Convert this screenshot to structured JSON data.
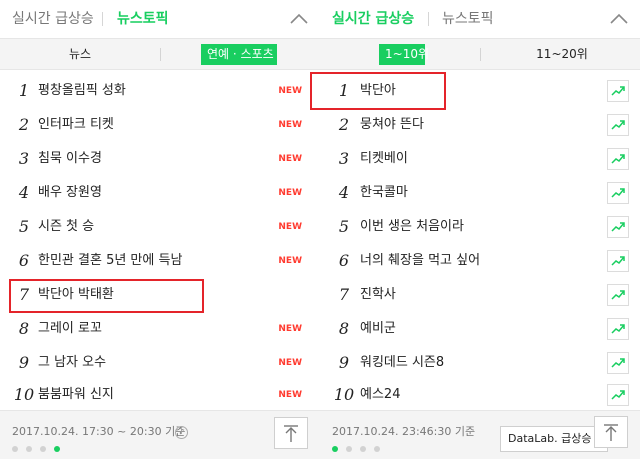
{
  "colors": {
    "accent": "#19ce60",
    "new": "#ff3b30",
    "highlight": "#e4242a"
  },
  "left": {
    "header": {
      "tab1": "실시간 급상승",
      "tab2": "뉴스토픽",
      "active": "tab2"
    },
    "subtabs": {
      "tab1": "뉴스",
      "tab2": "연예 · 스포츠",
      "active": "tab2"
    },
    "items": [
      {
        "rank": "1",
        "keyword": "평창올림픽 성화",
        "badge": "NEW"
      },
      {
        "rank": "2",
        "keyword": "인터파크 티켓",
        "badge": "NEW"
      },
      {
        "rank": "3",
        "keyword": "침묵 이수경",
        "badge": "NEW"
      },
      {
        "rank": "4",
        "keyword": "배우 장원영",
        "badge": "NEW"
      },
      {
        "rank": "5",
        "keyword": "시즌 첫 승",
        "badge": "NEW"
      },
      {
        "rank": "6",
        "keyword": "한민관 결혼 5년 만에 득남",
        "badge": "NEW"
      },
      {
        "rank": "7",
        "keyword": "박단아 박태환",
        "badge": ""
      },
      {
        "rank": "8",
        "keyword": "그레이 로꼬",
        "badge": "NEW"
      },
      {
        "rank": "9",
        "keyword": "그 남자 오수",
        "badge": "NEW"
      },
      {
        "rank": "10",
        "keyword": "붐붐파워 신지",
        "badge": "NEW"
      }
    ],
    "footer": {
      "date": "2017.10.24. 17:30 ~ 20:30 기준",
      "info": "i"
    }
  },
  "right": {
    "header": {
      "tab1": "실시간 급상승",
      "tab2": "뉴스토픽",
      "active": "tab1"
    },
    "subtabs": {
      "tab1": "1~10위",
      "tab2": "11~20위",
      "active": "tab1"
    },
    "items": [
      {
        "rank": "1",
        "keyword": "박단아"
      },
      {
        "rank": "2",
        "keyword": "뭉쳐야 뜬다"
      },
      {
        "rank": "3",
        "keyword": "티켓베이"
      },
      {
        "rank": "4",
        "keyword": "한국콜마"
      },
      {
        "rank": "5",
        "keyword": "이번 생은 처음이라"
      },
      {
        "rank": "6",
        "keyword": "너의 췌장을 먹고 싶어"
      },
      {
        "rank": "7",
        "keyword": "진학사"
      },
      {
        "rank": "8",
        "keyword": "예비군"
      },
      {
        "rank": "9",
        "keyword": "워킹데드 시즌8"
      },
      {
        "rank": "10",
        "keyword": "예스24"
      }
    ],
    "footer": {
      "date": "2017.10.24. 23:46:30 기준",
      "datalab": "DataLab. 급상승 트렌드"
    }
  },
  "icons": {
    "collapse": "chevron-up-icon",
    "trend": "trend-chart-icon",
    "top": "arrow-up-icon",
    "info": "info-icon"
  }
}
